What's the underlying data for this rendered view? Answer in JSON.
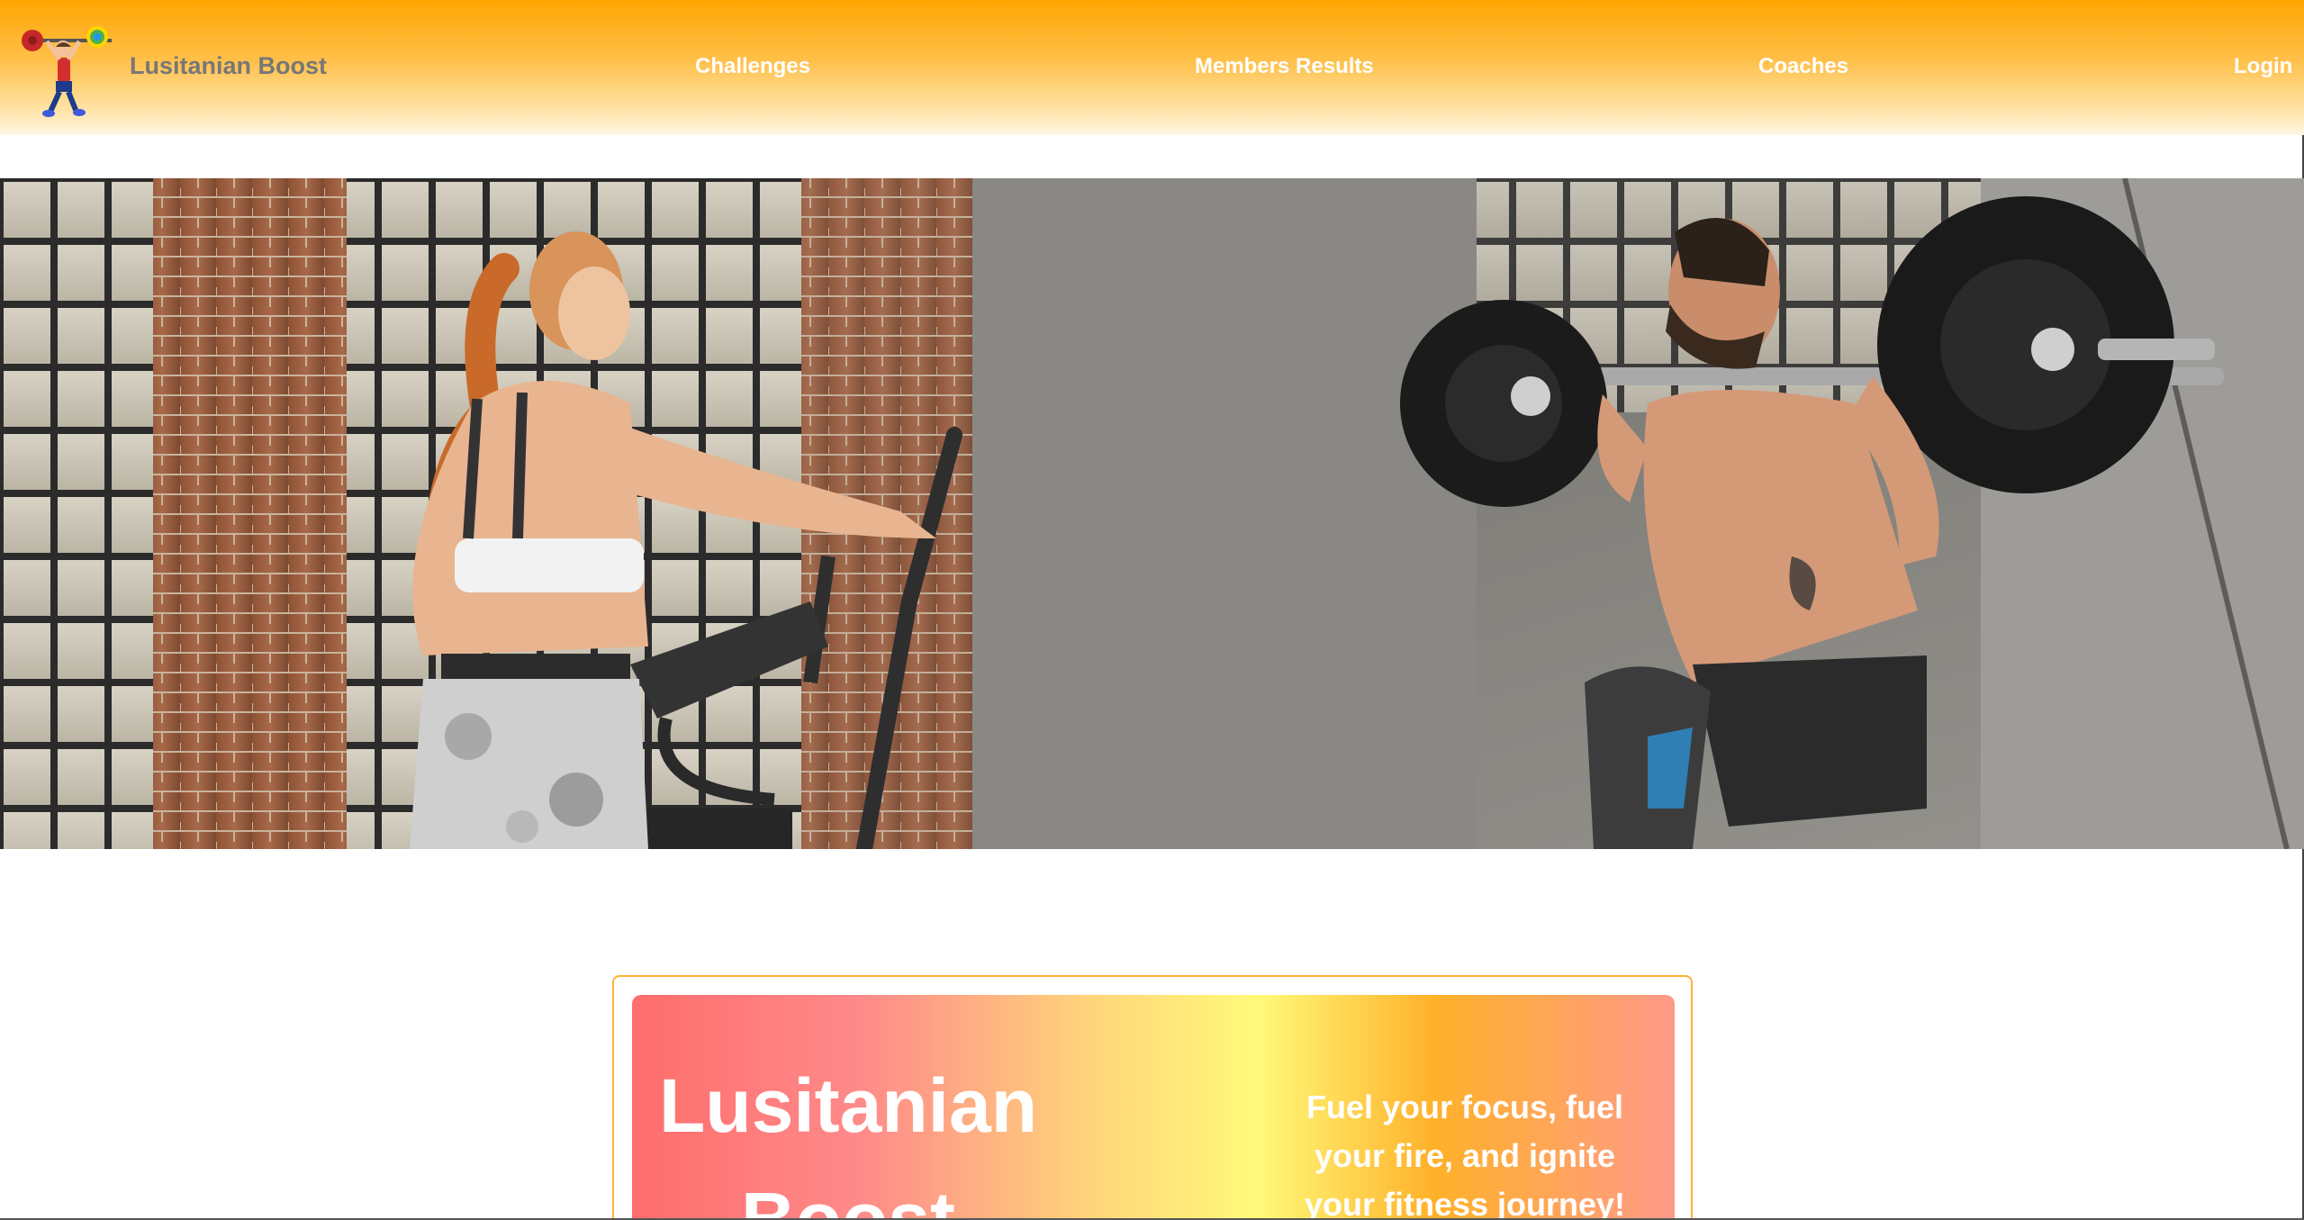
{
  "navbar": {
    "brand": "Lusitanian Boost",
    "links": [
      {
        "label": "Challenges"
      },
      {
        "label": "Members Results"
      },
      {
        "label": "Coaches"
      },
      {
        "label": "Login"
      }
    ],
    "logo_icon": "weightlifter-icon"
  },
  "hero": {
    "image": "gym-workout-photo",
    "colors": {
      "brick": "#9a5a3c",
      "concrete": "#8d8b86",
      "plate": "#1c1c1c"
    }
  },
  "intro_card": {
    "title": "Lusitanian Boost",
    "tagline": "Fuel your focus, fuel your fire, and ignite your fitness journey!"
  },
  "colors": {
    "accent": "#ffa500",
    "brand_text": "#777777",
    "nav_text": "#ffffff",
    "card_border": "#ffb13a"
  }
}
